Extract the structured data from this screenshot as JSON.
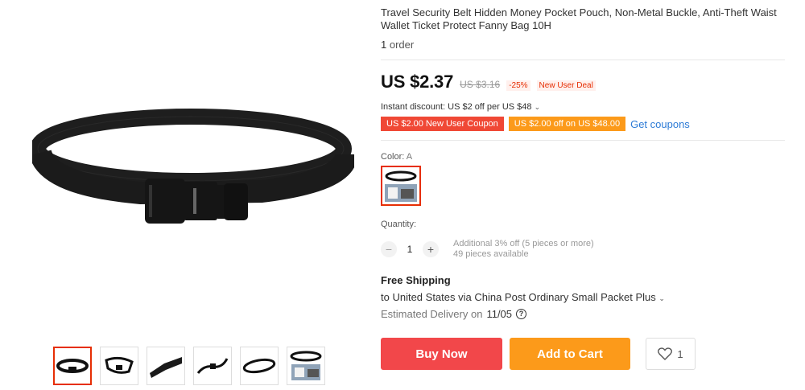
{
  "product": {
    "title": "Travel Security Belt Hidden Money Pocket Pouch, Non-Metal Buckle, Anti-Theft Waist Wallet Ticket Protect Fanny Bag 10H",
    "order_count": "1",
    "order_label": "order"
  },
  "pricing": {
    "price": "US $2.37",
    "old_price": "US $3.16",
    "discount": "-25%",
    "deal_badge": "New User Deal",
    "instant_discount": "Instant discount: US $2 off per US $48",
    "coupon_new_user": "US $2.00 New User Coupon",
    "coupon_off": "US $2.00 off on US $48.00",
    "get_coupons": "Get coupons"
  },
  "color": {
    "label": "Color:",
    "value": "A"
  },
  "quantity": {
    "label": "Quantity:",
    "value": "1",
    "minus": "−",
    "plus": "+",
    "note_discount": "Additional 3% off (5 pieces or more)",
    "note_available": "49 pieces available"
  },
  "shipping": {
    "title": "Free Shipping",
    "route": "to United States via China Post Ordinary Small Packet Plus",
    "delivery_label": "Estimated Delivery on",
    "delivery_date": "11/05"
  },
  "actions": {
    "buy_now": "Buy Now",
    "add_to_cart": "Add to Cart",
    "wishlist_count": "1"
  },
  "colors": {
    "accent_red": "#f2474a",
    "accent_orange": "#fc9a1a",
    "link_blue": "#2d7bd6"
  },
  "icons": [
    "chevron-down-icon",
    "help-icon",
    "heart-icon",
    "belt-image"
  ]
}
